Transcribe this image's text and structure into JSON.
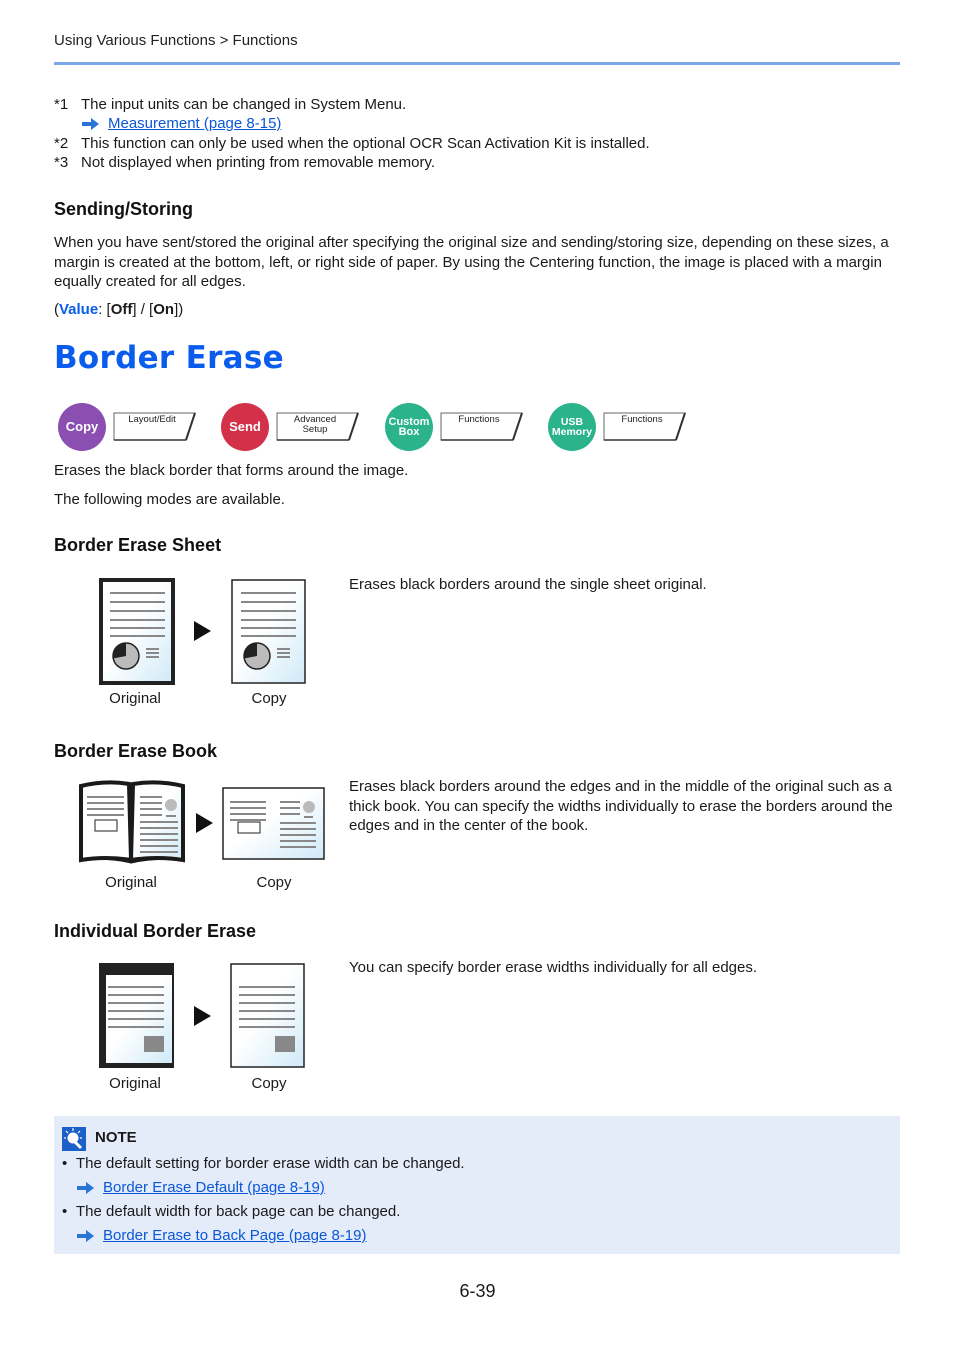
{
  "header": {
    "breadcrumb": "Using Various Functions > Functions"
  },
  "footnotes": [
    {
      "mark": "*1",
      "text": "The input units can be changed in System Menu.",
      "link": "Measurement (page 8-15)"
    },
    {
      "mark": "*2",
      "text": "This function can only be used when the optional OCR Scan Activation Kit is installed."
    },
    {
      "mark": "*3",
      "text": "Not displayed when printing from removable memory."
    }
  ],
  "sending_storing": {
    "heading": "Sending/Storing",
    "body": "When you have sent/stored the original after specifying the original size and sending/storing size, depending on these sizes, a margin is created at the bottom, left, or right side of paper. By using the Centering function, the image is placed with a margin equally created for all edges.",
    "value_label": "Value",
    "value_open": "(",
    "value_sep1": ": [",
    "value_off": "Off",
    "value_sep2": "] / [",
    "value_on": "On",
    "value_close": "])"
  },
  "section": {
    "title": "Border Erase",
    "modes": [
      {
        "circle": "Copy",
        "color": "#8a4fb0",
        "tab": "Layout/Edit"
      },
      {
        "circle": "Send",
        "color": "#d3304a",
        "tab": "Advanced Setup"
      },
      {
        "circle": "Custom Box",
        "color": "#2bb38c",
        "tab": "Functions"
      },
      {
        "circle": "USB Memory",
        "color": "#2bb38c",
        "tab": "Functions"
      }
    ],
    "intro1": "Erases the black border that forms around the image.",
    "intro2": "The following modes are available."
  },
  "sheet": {
    "heading": "Border Erase Sheet",
    "description": "Erases black borders around the single sheet original.",
    "caption_original": "Original",
    "caption_copy": "Copy"
  },
  "book": {
    "heading": "Border Erase Book",
    "description": "Erases black borders around the edges and in the middle of the original such as a thick book. You can specify the widths individually to erase the borders around the edges and in the center of the book.",
    "caption_original": "Original",
    "caption_copy": "Copy"
  },
  "individual": {
    "heading": "Individual Border Erase",
    "description": "You can specify border erase widths individually for all edges.",
    "caption_original": "Original",
    "caption_copy": "Copy"
  },
  "note": {
    "title": "NOTE",
    "items": [
      {
        "text": "The default setting for border erase width can be changed.",
        "link": "Border Erase Default (page 8-19)"
      },
      {
        "text": "The default width for back page can be changed.",
        "link": "Border Erase to Back Page (page 8-19)"
      }
    ]
  },
  "footer": {
    "page_number": "6-39"
  }
}
